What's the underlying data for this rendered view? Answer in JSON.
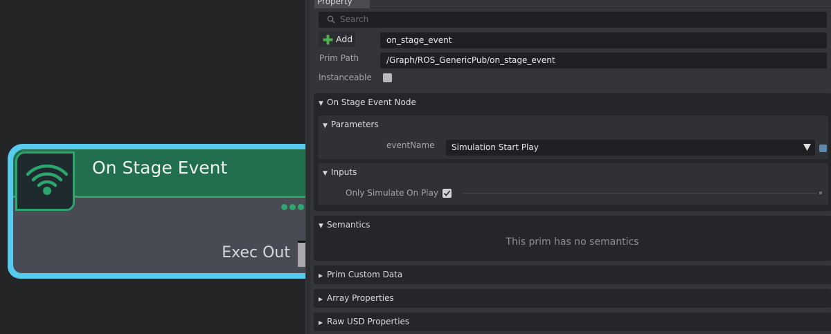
{
  "graph": {
    "node": {
      "title": "On Stage Event",
      "exec_out_label": "Exec Out"
    }
  },
  "panel": {
    "tab_label": "Property",
    "search": {
      "placeholder": "Search"
    },
    "add_button_label": "Add",
    "name_value": "on_stage_event",
    "prim_path_label": "Prim Path",
    "prim_path_value": "/Graph/ROS_GenericPub/on_stage_event",
    "instanceable_label": "Instanceable",
    "sections": {
      "node": {
        "title": "On Stage Event Node",
        "parameters": {
          "title": "Parameters",
          "event_name_label": "eventName",
          "event_name_value": "Simulation Start Play"
        },
        "inputs": {
          "title": "Inputs",
          "only_simulate_label": "Only Simulate On Play",
          "only_simulate_checked": true
        }
      },
      "semantics": {
        "title": "Semantics",
        "empty_message": "This prim has no semantics"
      },
      "prim_custom_data": {
        "title": "Prim Custom Data"
      },
      "array_properties": {
        "title": "Array Properties"
      },
      "raw_usd_properties": {
        "title": "Raw USD Properties"
      }
    }
  },
  "colors": {
    "node_border": "#57cbee",
    "node_header": "#216f4c",
    "node_accent": "#2ca66d",
    "node_body": "#494b54",
    "panel_bg": "#343538",
    "field_bg": "#1f2023"
  },
  "icons": {
    "node_icon": "wireless-signal-icon",
    "search": "search-icon",
    "add": "plus-icon",
    "expanded": "triangle-down-icon",
    "collapsed": "triangle-right-icon",
    "dropdown": "dropdown-arrow-icon"
  }
}
